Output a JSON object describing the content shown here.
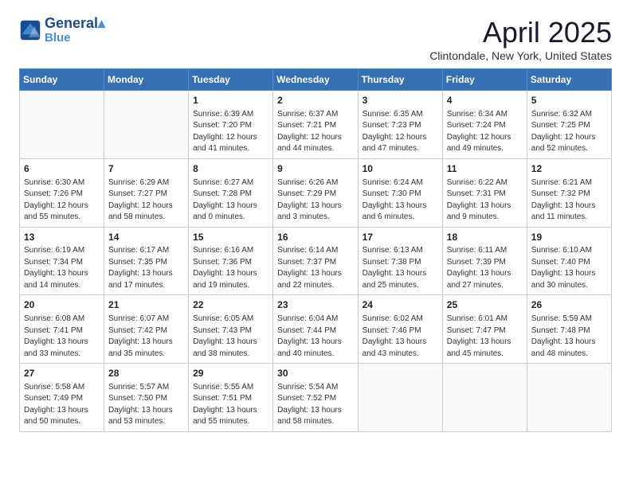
{
  "header": {
    "logo_line1": "General",
    "logo_line2": "Blue",
    "month": "April 2025",
    "location": "Clintondale, New York, United States"
  },
  "days_of_week": [
    "Sunday",
    "Monday",
    "Tuesday",
    "Wednesday",
    "Thursday",
    "Friday",
    "Saturday"
  ],
  "weeks": [
    [
      {
        "day": "",
        "sunrise": "",
        "sunset": "",
        "daylight": ""
      },
      {
        "day": "",
        "sunrise": "",
        "sunset": "",
        "daylight": ""
      },
      {
        "day": "1",
        "sunrise": "Sunrise: 6:39 AM",
        "sunset": "Sunset: 7:20 PM",
        "daylight": "Daylight: 12 hours and 41 minutes."
      },
      {
        "day": "2",
        "sunrise": "Sunrise: 6:37 AM",
        "sunset": "Sunset: 7:21 PM",
        "daylight": "Daylight: 12 hours and 44 minutes."
      },
      {
        "day": "3",
        "sunrise": "Sunrise: 6:35 AM",
        "sunset": "Sunset: 7:23 PM",
        "daylight": "Daylight: 12 hours and 47 minutes."
      },
      {
        "day": "4",
        "sunrise": "Sunrise: 6:34 AM",
        "sunset": "Sunset: 7:24 PM",
        "daylight": "Daylight: 12 hours and 49 minutes."
      },
      {
        "day": "5",
        "sunrise": "Sunrise: 6:32 AM",
        "sunset": "Sunset: 7:25 PM",
        "daylight": "Daylight: 12 hours and 52 minutes."
      }
    ],
    [
      {
        "day": "6",
        "sunrise": "Sunrise: 6:30 AM",
        "sunset": "Sunset: 7:26 PM",
        "daylight": "Daylight: 12 hours and 55 minutes."
      },
      {
        "day": "7",
        "sunrise": "Sunrise: 6:29 AM",
        "sunset": "Sunset: 7:27 PM",
        "daylight": "Daylight: 12 hours and 58 minutes."
      },
      {
        "day": "8",
        "sunrise": "Sunrise: 6:27 AM",
        "sunset": "Sunset: 7:28 PM",
        "daylight": "Daylight: 13 hours and 0 minutes."
      },
      {
        "day": "9",
        "sunrise": "Sunrise: 6:26 AM",
        "sunset": "Sunset: 7:29 PM",
        "daylight": "Daylight: 13 hours and 3 minutes."
      },
      {
        "day": "10",
        "sunrise": "Sunrise: 6:24 AM",
        "sunset": "Sunset: 7:30 PM",
        "daylight": "Daylight: 13 hours and 6 minutes."
      },
      {
        "day": "11",
        "sunrise": "Sunrise: 6:22 AM",
        "sunset": "Sunset: 7:31 PM",
        "daylight": "Daylight: 13 hours and 9 minutes."
      },
      {
        "day": "12",
        "sunrise": "Sunrise: 6:21 AM",
        "sunset": "Sunset: 7:32 PM",
        "daylight": "Daylight: 13 hours and 11 minutes."
      }
    ],
    [
      {
        "day": "13",
        "sunrise": "Sunrise: 6:19 AM",
        "sunset": "Sunset: 7:34 PM",
        "daylight": "Daylight: 13 hours and 14 minutes."
      },
      {
        "day": "14",
        "sunrise": "Sunrise: 6:17 AM",
        "sunset": "Sunset: 7:35 PM",
        "daylight": "Daylight: 13 hours and 17 minutes."
      },
      {
        "day": "15",
        "sunrise": "Sunrise: 6:16 AM",
        "sunset": "Sunset: 7:36 PM",
        "daylight": "Daylight: 13 hours and 19 minutes."
      },
      {
        "day": "16",
        "sunrise": "Sunrise: 6:14 AM",
        "sunset": "Sunset: 7:37 PM",
        "daylight": "Daylight: 13 hours and 22 minutes."
      },
      {
        "day": "17",
        "sunrise": "Sunrise: 6:13 AM",
        "sunset": "Sunset: 7:38 PM",
        "daylight": "Daylight: 13 hours and 25 minutes."
      },
      {
        "day": "18",
        "sunrise": "Sunrise: 6:11 AM",
        "sunset": "Sunset: 7:39 PM",
        "daylight": "Daylight: 13 hours and 27 minutes."
      },
      {
        "day": "19",
        "sunrise": "Sunrise: 6:10 AM",
        "sunset": "Sunset: 7:40 PM",
        "daylight": "Daylight: 13 hours and 30 minutes."
      }
    ],
    [
      {
        "day": "20",
        "sunrise": "Sunrise: 6:08 AM",
        "sunset": "Sunset: 7:41 PM",
        "daylight": "Daylight: 13 hours and 33 minutes."
      },
      {
        "day": "21",
        "sunrise": "Sunrise: 6:07 AM",
        "sunset": "Sunset: 7:42 PM",
        "daylight": "Daylight: 13 hours and 35 minutes."
      },
      {
        "day": "22",
        "sunrise": "Sunrise: 6:05 AM",
        "sunset": "Sunset: 7:43 PM",
        "daylight": "Daylight: 13 hours and 38 minutes."
      },
      {
        "day": "23",
        "sunrise": "Sunrise: 6:04 AM",
        "sunset": "Sunset: 7:44 PM",
        "daylight": "Daylight: 13 hours and 40 minutes."
      },
      {
        "day": "24",
        "sunrise": "Sunrise: 6:02 AM",
        "sunset": "Sunset: 7:46 PM",
        "daylight": "Daylight: 13 hours and 43 minutes."
      },
      {
        "day": "25",
        "sunrise": "Sunrise: 6:01 AM",
        "sunset": "Sunset: 7:47 PM",
        "daylight": "Daylight: 13 hours and 45 minutes."
      },
      {
        "day": "26",
        "sunrise": "Sunrise: 5:59 AM",
        "sunset": "Sunset: 7:48 PM",
        "daylight": "Daylight: 13 hours and 48 minutes."
      }
    ],
    [
      {
        "day": "27",
        "sunrise": "Sunrise: 5:58 AM",
        "sunset": "Sunset: 7:49 PM",
        "daylight": "Daylight: 13 hours and 50 minutes."
      },
      {
        "day": "28",
        "sunrise": "Sunrise: 5:57 AM",
        "sunset": "Sunset: 7:50 PM",
        "daylight": "Daylight: 13 hours and 53 minutes."
      },
      {
        "day": "29",
        "sunrise": "Sunrise: 5:55 AM",
        "sunset": "Sunset: 7:51 PM",
        "daylight": "Daylight: 13 hours and 55 minutes."
      },
      {
        "day": "30",
        "sunrise": "Sunrise: 5:54 AM",
        "sunset": "Sunset: 7:52 PM",
        "daylight": "Daylight: 13 hours and 58 minutes."
      },
      {
        "day": "",
        "sunrise": "",
        "sunset": "",
        "daylight": ""
      },
      {
        "day": "",
        "sunrise": "",
        "sunset": "",
        "daylight": ""
      },
      {
        "day": "",
        "sunrise": "",
        "sunset": "",
        "daylight": ""
      }
    ]
  ]
}
